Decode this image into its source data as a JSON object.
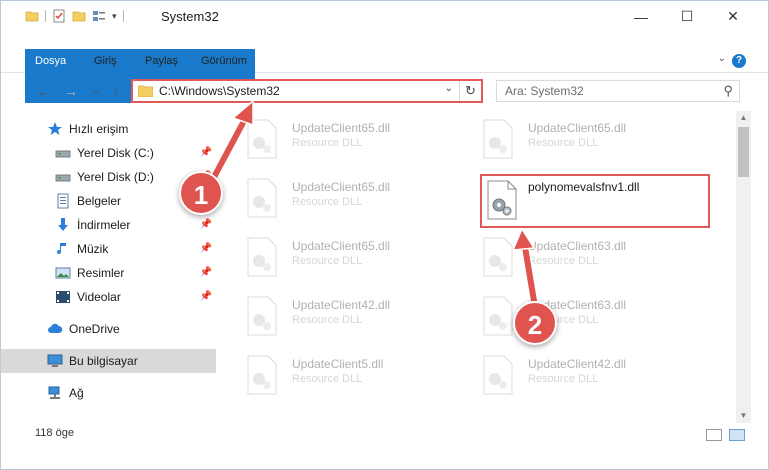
{
  "window": {
    "title": "System32",
    "buttons": {
      "minimize": "—",
      "maximize": "☐",
      "close": "✕"
    }
  },
  "ribbon": {
    "tabs": [
      "Dosya",
      "Giriş",
      "Paylaş",
      "Görünüm"
    ],
    "help": "?"
  },
  "nav": {
    "back": "←",
    "forward": "→",
    "recent": "⌄",
    "up": "↑",
    "address_path": "C:\\Windows\\System32",
    "search_placeholder": "Ara: System32"
  },
  "sidebar": {
    "items": [
      {
        "label": "Hızlı erişim",
        "icon": "star-icon"
      },
      {
        "label": "Yerel Disk (C:)",
        "icon": "drive-icon",
        "pinned": true
      },
      {
        "label": "Yerel Disk (D:)",
        "icon": "drive-icon",
        "pinned": true
      },
      {
        "label": "Belgeler",
        "icon": "documents-icon",
        "pinned": true
      },
      {
        "label": "İndirmeler",
        "icon": "download-icon",
        "pinned": true
      },
      {
        "label": "Müzik",
        "icon": "music-icon",
        "pinned": true
      },
      {
        "label": "Resimler",
        "icon": "pictures-icon",
        "pinned": true
      },
      {
        "label": "Videolar",
        "icon": "video-icon",
        "pinned": true
      },
      {
        "label": "OneDrive",
        "icon": "cloud-icon"
      },
      {
        "label": "Bu bilgisayar",
        "icon": "computer-icon",
        "selected": true
      },
      {
        "label": "Ağ",
        "icon": "network-icon"
      }
    ]
  },
  "files": {
    "left": [
      {
        "name": "UpdateClient65.dll",
        "desc": "Resource DLL"
      },
      {
        "name": "UpdateClient65.dll",
        "desc": "Resource DLL"
      },
      {
        "name": "UpdateClient65.dll",
        "desc": "Resource DLL"
      },
      {
        "name": "UpdateClient42.dll",
        "desc": "Resource DLL"
      },
      {
        "name": "UpdateClient5.dll",
        "desc": "Resource DLL"
      }
    ],
    "right": [
      {
        "name": "UpdateClient65.dll",
        "desc": "Resource DLL"
      },
      {
        "name": "polynomevalsfnv1.dll",
        "desc": "",
        "highlight": true
      },
      {
        "name": "UpdateClient63.dll",
        "desc": "Resource DLL"
      },
      {
        "name": "UpdateClient63.dll",
        "desc": "Resource DLL"
      },
      {
        "name": "UpdateClient42.dll",
        "desc": "Resource DLL"
      }
    ]
  },
  "status": {
    "item_count": "118 öge"
  },
  "annotations": {
    "step1": "1",
    "step2": "2"
  },
  "colors": {
    "accent": "#1979ca",
    "highlight": "#e05a5a",
    "callout": "#e0544f"
  }
}
